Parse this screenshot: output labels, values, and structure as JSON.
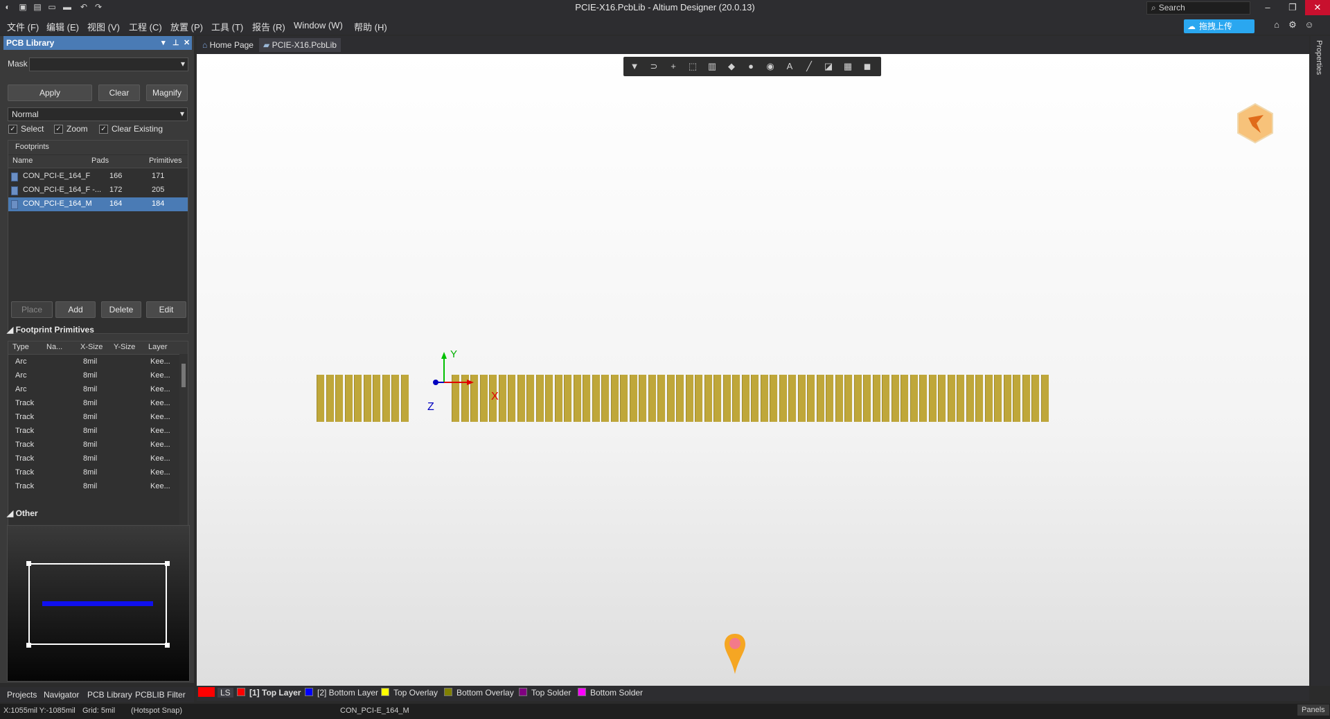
{
  "window": {
    "title": "PCIE-X16.PcbLib - Altium Designer (20.0.13)",
    "search_placeholder": "Search",
    "minimize": "–",
    "restore": "❐",
    "close": "✕"
  },
  "menu": [
    "文件 (F)",
    "编辑 (E)",
    "视图 (V)",
    "工程 (C)",
    "放置 (P)",
    "工具 (T)",
    "报告 (R)",
    "Window (W)",
    "帮助 (H)"
  ],
  "upload_button": "拖拽上传",
  "panel": {
    "title": "PCB Library",
    "mask_label": "Mask",
    "mask_value": "",
    "apply": "Apply",
    "clear": "Clear",
    "magnify": "Magnify",
    "mode": "Normal",
    "checks": {
      "select": "Select",
      "zoom": "Zoom",
      "clear_existing": "Clear Existing"
    },
    "footprints_label": "Footprints",
    "fp_headers": {
      "name": "Name",
      "pads": "Pads",
      "primitives": "Primitives"
    },
    "footprints": [
      {
        "name": "CON_PCI-E_164_F",
        "pads": "166",
        "primitives": "171",
        "selected": false
      },
      {
        "name": "CON_PCI-E_164_F -...",
        "pads": "172",
        "primitives": "205",
        "selected": false
      },
      {
        "name": "CON_PCI-E_164_M",
        "pads": "164",
        "primitives": "184",
        "selected": true
      }
    ],
    "actions": {
      "place": "Place",
      "add": "Add",
      "delete": "Delete",
      "edit": "Edit"
    },
    "primitives_label": "Footprint Primitives",
    "prim_headers": {
      "type": "Type",
      "name": "Na...",
      "xsize": "X-Size",
      "ysize": "Y-Size",
      "layer": "Layer"
    },
    "primitives": [
      {
        "type": "Arc",
        "xsize": "8mil",
        "layer": "Kee..."
      },
      {
        "type": "Arc",
        "xsize": "8mil",
        "layer": "Kee..."
      },
      {
        "type": "Arc",
        "xsize": "8mil",
        "layer": "Kee..."
      },
      {
        "type": "Track",
        "xsize": "8mil",
        "layer": "Kee..."
      },
      {
        "type": "Track",
        "xsize": "8mil",
        "layer": "Kee..."
      },
      {
        "type": "Track",
        "xsize": "8mil",
        "layer": "Kee..."
      },
      {
        "type": "Track",
        "xsize": "8mil",
        "layer": "Kee..."
      },
      {
        "type": "Track",
        "xsize": "8mil",
        "layer": "Kee..."
      },
      {
        "type": "Track",
        "xsize": "8mil",
        "layer": "Kee..."
      },
      {
        "type": "Track",
        "xsize": "8mil",
        "layer": "Kee..."
      }
    ],
    "other_label": "Other"
  },
  "panel_tabs": [
    "Projects",
    "Navigator",
    "PCB Library",
    "PCBLIB Filter"
  ],
  "doc_tabs": [
    "Home Page",
    "PCIE-X16.PcbLib"
  ],
  "axes": {
    "x": "X",
    "y": "Y",
    "z": "Z"
  },
  "layers": [
    {
      "label": "LS",
      "color": "#ff0000"
    },
    {
      "label": "[1] Top Layer",
      "color": "#ff0000",
      "active": true
    },
    {
      "label": "[2] Bottom Layer",
      "color": "#0000ff"
    },
    {
      "label": "Top Overlay",
      "color": "#ffff00"
    },
    {
      "label": "Bottom Overlay",
      "color": "#808000"
    },
    {
      "label": "Top Solder",
      "color": "#800080"
    },
    {
      "label": "Bottom Solder",
      "color": "#ff00ff"
    }
  ],
  "right_panel_label": "Properties",
  "status": {
    "coords": "X:1055mil Y:-1085mil",
    "grid": "Grid: 5mil",
    "snap": "(Hotspot Snap)",
    "component": "CON_PCI-E_164_M",
    "panels": "Panels"
  },
  "colors": {
    "accent": "#4a7bb5",
    "pad": "#bfa73a",
    "upload": "#2aa7f0"
  }
}
